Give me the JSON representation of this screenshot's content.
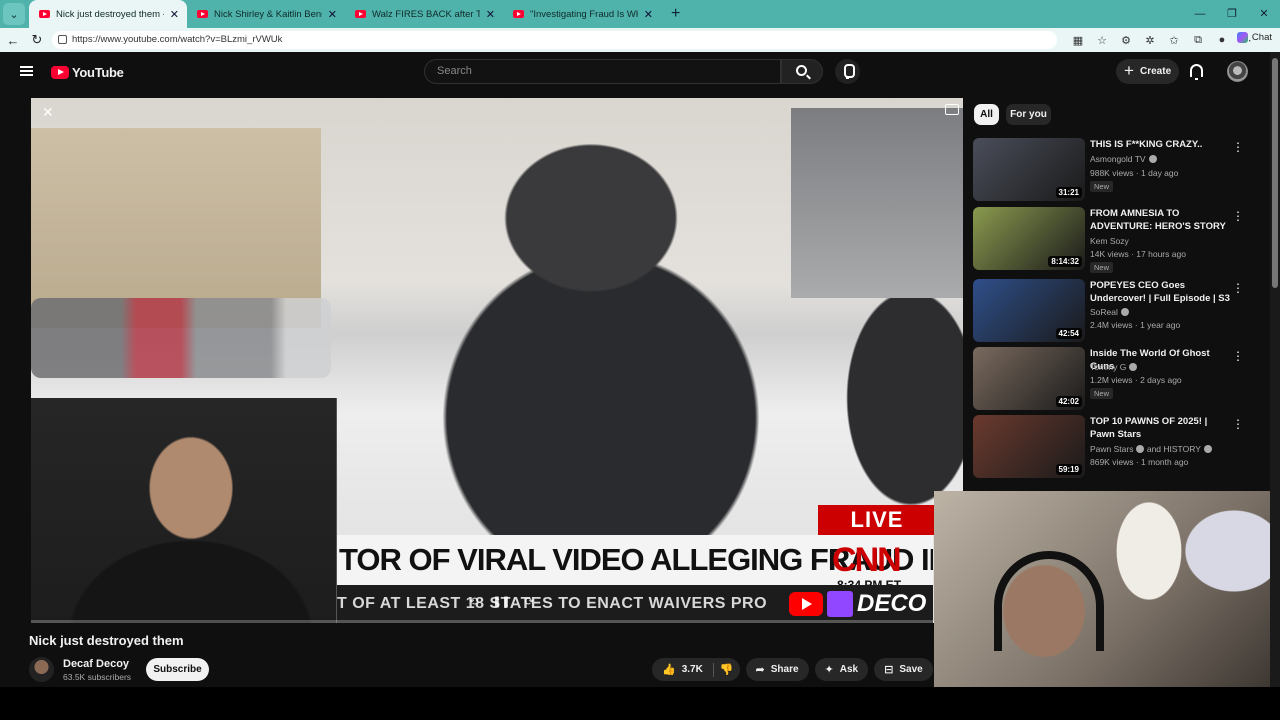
{
  "browser": {
    "tabs": [
      {
        "label": "Nick just destroyed them - YouTube",
        "active": true
      },
      {
        "label": "Nick Shirley & Kaitlin Bennett vs. F",
        "active": false
      },
      {
        "label": "Walz FIRES BACK after Trump team",
        "active": false
      },
      {
        "label": "\"Investigating Fraud Is WHITE SUP",
        "active": false
      }
    ],
    "url": "https://www.youtube.com/watch?v=BLzmi_rVWUk",
    "chat_label": "Chat"
  },
  "masthead": {
    "logo_text": "YouTube",
    "search_placeholder": "Search",
    "create_label": "Create"
  },
  "video": {
    "title": "Nick just destroyed them",
    "chyron": {
      "live": "LIVE",
      "headline": "TOR OF VIRAL VIDEO ALLEGING FRAUD IN MN",
      "network": "CNN",
      "time": "8:34 PM ET",
      "ticker": "T OF AT LEAST 18 STATES TO ENACT WAIVERS PRO",
      "overlay_brand": "DECO"
    },
    "channel": {
      "name": "Decaf Decoy",
      "subscribers": "63.5K subscribers",
      "subscribe_label": "Subscribe"
    },
    "actions": {
      "likes": "3.7K",
      "share": "Share",
      "ask": "Ask",
      "save": "Save"
    }
  },
  "chips": [
    "All",
    "For you"
  ],
  "recommendations": [
    {
      "title": "THIS IS F**KING CRAZY..",
      "channel": "Asmongold TV",
      "meta": "988K views · 1 day ago",
      "badge": "New",
      "duration": "31:21",
      "color": "#4a4e5a"
    },
    {
      "title": "FROM AMNESIA TO ADVENTURE: HERO'S STORY ...",
      "channel": "Kem Sozy",
      "meta": "14K views · 17 hours ago",
      "badge": "New",
      "duration": "8:14:32",
      "color": "#8a9a4e"
    },
    {
      "title": "POPEYES CEO Goes Undercover! | Full Episode | S3 ...",
      "channel": "SoReal",
      "meta": "2.4M views · 1 year ago",
      "badge": "",
      "duration": "42:54",
      "color": "#2f4f8a"
    },
    {
      "title": "Inside The World Of Ghost Guns",
      "channel": "Tommy G",
      "meta": "1.2M views · 2 days ago",
      "badge": "New",
      "duration": "42:02",
      "color": "#7a6a5e"
    },
    {
      "title": "TOP 10 PAWNS OF 2025! | Pawn Stars",
      "channel": "Pawn Stars",
      "channel_extra": "and HISTORY",
      "meta": "869K views · 1 month ago",
      "badge": "",
      "duration": "59:19",
      "color": "#6b3a2e"
    }
  ]
}
